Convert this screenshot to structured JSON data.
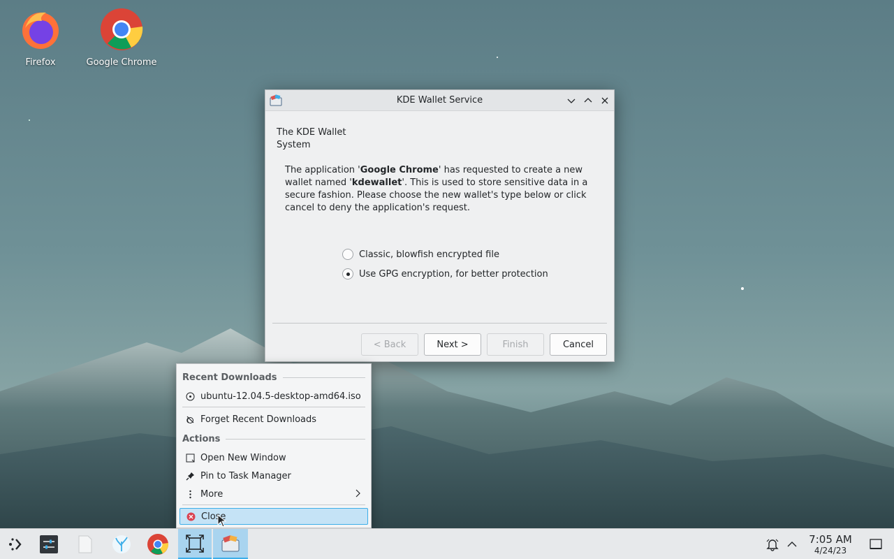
{
  "desktop": {
    "icons": [
      {
        "label": "Firefox",
        "icon": "firefox-icon"
      },
      {
        "label": "Google Chrome",
        "icon": "chrome-icon"
      }
    ]
  },
  "dialog": {
    "title": "KDE Wallet Service",
    "heading": "The KDE Wallet System",
    "message_parts": {
      "p1": "The application '",
      "app": "Google Chrome",
      "p2": "' has requested to create a new wallet named '",
      "wallet": "kdewallet",
      "p3": "'. This is used to store sensitive data in a secure fashion. Please choose the new wallet's type below or click cancel to deny the application's request."
    },
    "options": [
      {
        "label": "Classic, blowfish encrypted file",
        "selected": false
      },
      {
        "label": "Use GPG encryption, for better protection",
        "selected": true
      }
    ],
    "buttons": {
      "back": "< Back",
      "next": "Next >",
      "finish": "Finish",
      "cancel": "Cancel"
    }
  },
  "context_menu": {
    "recent_header": "Recent Downloads",
    "recent_item": "ubuntu-12.04.5-desktop-amd64.iso",
    "forget": "Forget Recent Downloads",
    "actions_header": "Actions",
    "open_new_window": "Open New Window",
    "pin": "Pin to Task Manager",
    "more": "More",
    "close": "Close"
  },
  "taskbar": {
    "items": [
      "application-launcher-icon",
      "settings-icon",
      "files-icon",
      "discover-icon",
      "chrome-icon",
      "window-switcher-icon",
      "kwallet-icon"
    ],
    "clock": {
      "time": "7:05 AM",
      "date": "4/24/23"
    }
  },
  "colors": {
    "accent": "#3daee9",
    "highlight": "#c5e3f6"
  }
}
